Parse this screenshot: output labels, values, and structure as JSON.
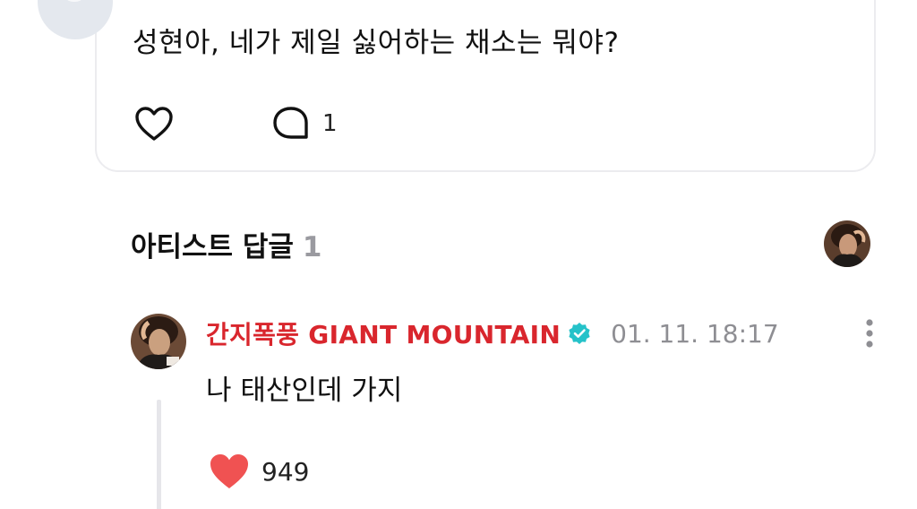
{
  "post": {
    "text": "성현아, 네가 제일 싫어하는 채소는 뭐야?",
    "comment_count": "1",
    "icons": {
      "like": "heart-outline-icon",
      "comment": "speech-bubble-icon"
    }
  },
  "artist_replies": {
    "title": "아티스트 답글",
    "count": "1"
  },
  "reply": {
    "author": "간지폭풍 GIANT MOUNTAIN",
    "timestamp": "01. 11. 18:17",
    "text": "나 태산인데 가지",
    "like_count": "949",
    "icons": {
      "verified": "verified-badge-icon",
      "more": "more-vertical-icon",
      "like": "heart-filled-icon"
    }
  },
  "colors": {
    "author_name": "#d9262d",
    "verified_badge": "#25c2c9",
    "liked_heart": "#f05252",
    "muted_text": "#8e8e93",
    "card_border": "#ececef"
  }
}
